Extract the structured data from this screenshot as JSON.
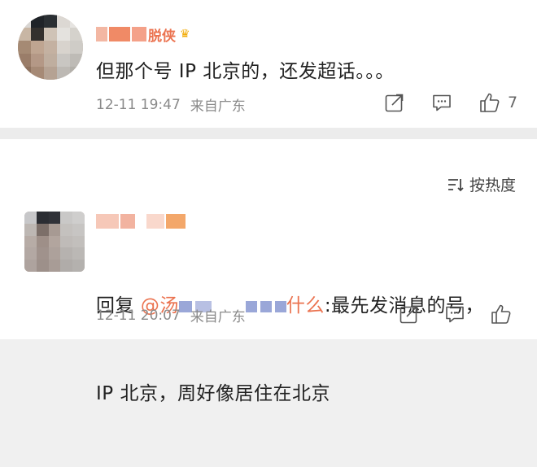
{
  "comment1": {
    "username": "██████脱侌",
    "crown_icon": "crown-icon",
    "text": "但那个号 IP 北京的，还发超话。。。",
    "time": "12-11 19:47",
    "location": "来自广东",
    "like_count": "7"
  },
  "sort": {
    "label": "按热度",
    "icon": "sort-lines-icon"
  },
  "comment2": {
    "username": "█████",
    "reply_prefix": "回复 ",
    "mention_start": "@汤",
    "mention_end": "什么",
    "text_after": ":最先发消息的号，",
    "text_line2": "IP 北京，周好像居住在北京",
    "time": "12-11 20:07",
    "location": "来自广东"
  },
  "colors": {
    "accent": "#eb7350",
    "meta": "#8a8a8a",
    "text": "#222222"
  }
}
